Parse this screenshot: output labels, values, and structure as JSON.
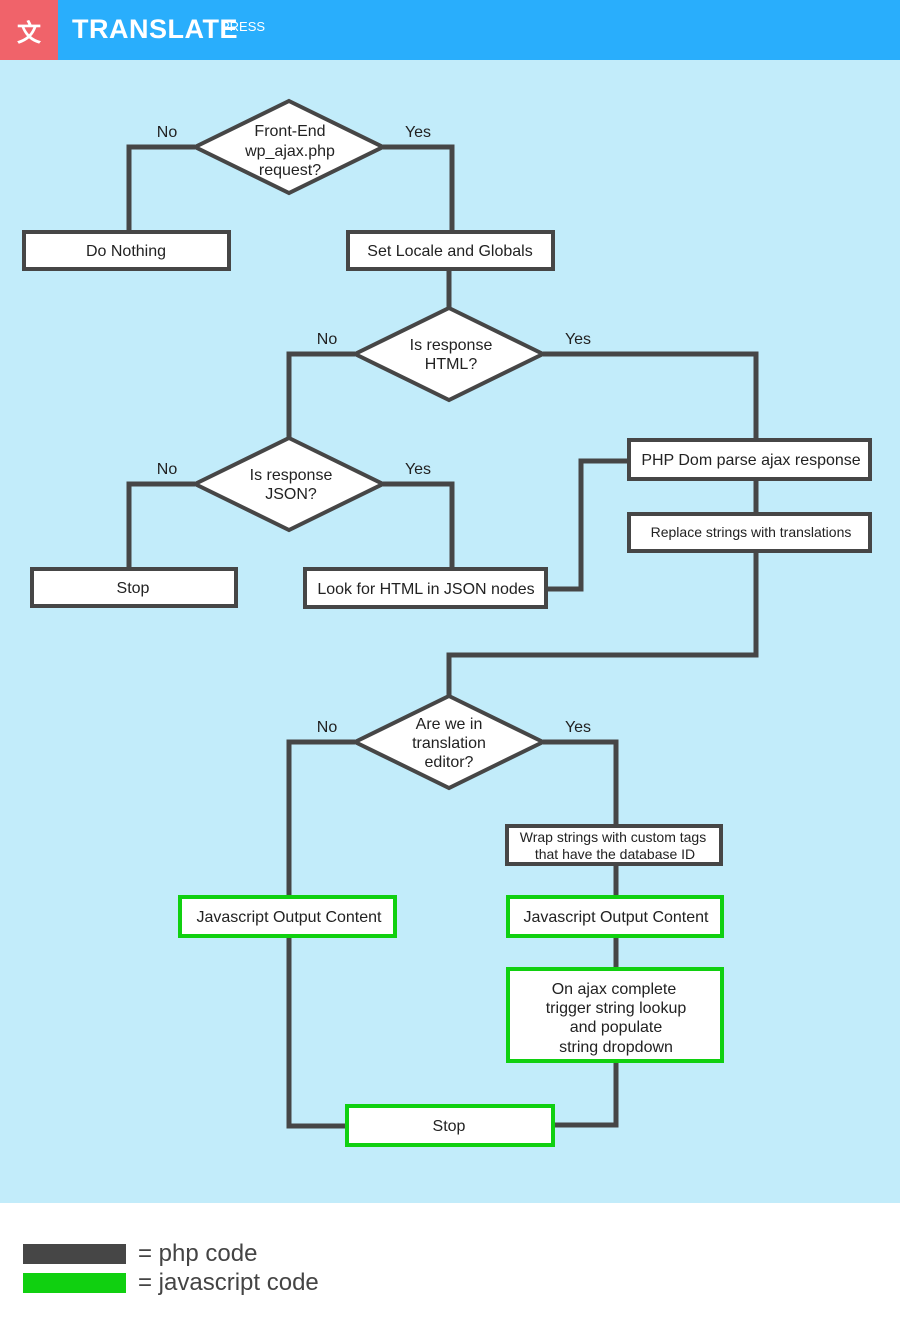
{
  "header": {
    "logo_glyph": "文",
    "brand": "TRANSLATE",
    "brand_sub": "PRESS",
    "colors": {
      "logo_bg": "#f0636a",
      "bar_bg": "#29aefc"
    }
  },
  "colors": {
    "php": "#464646",
    "javascript": "#10d010",
    "canvas": "#c2ecfa"
  },
  "flowchart": {
    "decisions": {
      "front_end": [
        "Front-End",
        "wp_ajax.php",
        "request?"
      ],
      "is_html": [
        "Is response",
        "HTML?"
      ],
      "is_json": [
        "Is response",
        "JSON?"
      ],
      "in_editor": [
        "Are we in",
        "translation",
        "editor?"
      ]
    },
    "boxes": {
      "do_nothing": "Do Nothing",
      "set_locale": "Set Locale and Globals",
      "stop_1": "Stop",
      "look_html": "Look for HTML in JSON nodes",
      "php_dom": "PHP Dom parse ajax response",
      "replace": "Replace strings with translations",
      "wrap": [
        "Wrap strings with custom tags",
        "that have the database ID"
      ],
      "js_output_no": "Javascript Output Content",
      "js_output_yes": "Javascript Output Content",
      "ajax_complete": [
        "On ajax complete",
        "trigger string lookup",
        "and populate",
        "string dropdown"
      ],
      "stop_2": "Stop"
    },
    "labels": {
      "no": "No",
      "yes": "Yes"
    }
  },
  "legend": [
    {
      "label": "= php code",
      "color": "#464646"
    },
    {
      "label": "= javascript code",
      "color": "#10d010"
    }
  ]
}
